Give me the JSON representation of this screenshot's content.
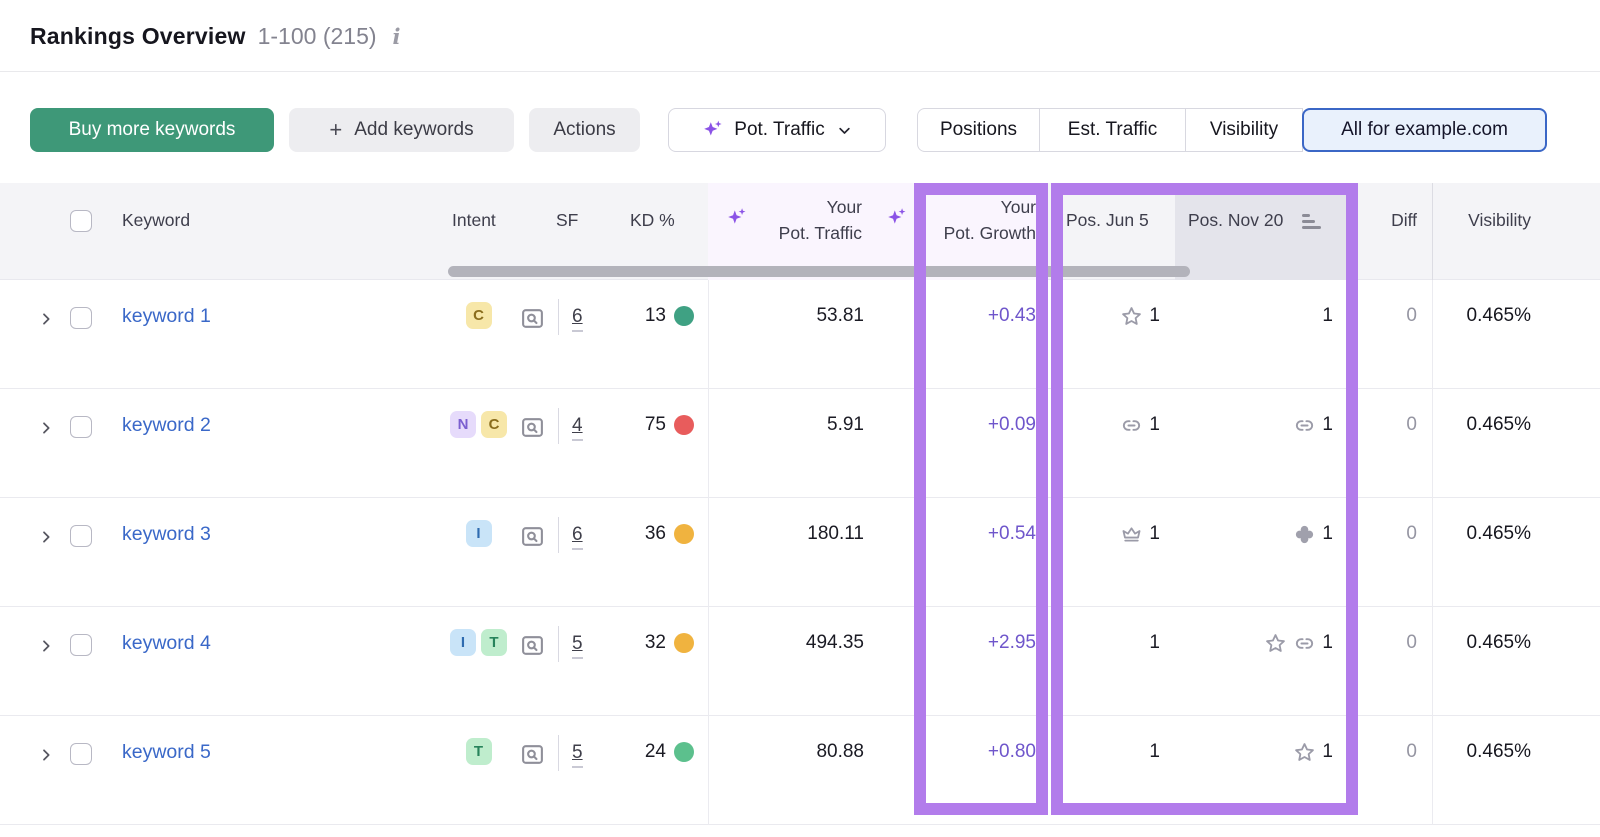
{
  "header": {
    "title": "Rankings Overview",
    "range": "1-100 (215)",
    "info_icon": "i"
  },
  "toolbar": {
    "buy_label": "Buy more keywords",
    "add_label": "Add keywords",
    "add_plus": "+",
    "actions_label": "Actions",
    "metric_dropdown_label": "Pot. Traffic",
    "tabs": [
      {
        "label": "Positions",
        "selected": false
      },
      {
        "label": "Est. Traffic",
        "selected": false
      },
      {
        "label": "Visibility",
        "selected": false
      },
      {
        "label": "All for example.com",
        "selected": true
      }
    ]
  },
  "table": {
    "columns": {
      "keyword": "Keyword",
      "intent": "Intent",
      "sf": "SF",
      "kd": "KD %",
      "pot_traffic_line1": "Your",
      "pot_traffic_line2": "Pot. Traffic",
      "pot_growth_line1": "Your",
      "pot_growth_line2": "Pot. Growth",
      "pos_jun5": "Pos. Jun 5",
      "pos_nov20": "Pos. Nov 20",
      "diff": "Diff",
      "visibility": "Visibility"
    },
    "sorted_column": "Pos. Nov 20",
    "rows": [
      {
        "keyword": "keyword 1",
        "intents": [
          "C"
        ],
        "sf": "6",
        "kd": "13",
        "kd_dot_color": "#3fa183",
        "pot_traffic": "53.81",
        "pot_growth": "+0.43",
        "pos_jun5": {
          "icons": [
            "star"
          ],
          "value": "1"
        },
        "pos_nov20": {
          "icons": [],
          "value": "1"
        },
        "diff": "0",
        "visibility": "0.465%"
      },
      {
        "keyword": "keyword 2",
        "intents": [
          "N",
          "C"
        ],
        "sf": "4",
        "kd": "75",
        "kd_dot_color": "#e85c5c",
        "pot_traffic": "5.91",
        "pot_growth": "+0.09",
        "pos_jun5": {
          "icons": [
            "link"
          ],
          "value": "1"
        },
        "pos_nov20": {
          "icons": [
            "link"
          ],
          "value": "1"
        },
        "diff": "0",
        "visibility": "0.465%"
      },
      {
        "keyword": "keyword 3",
        "intents": [
          "I"
        ],
        "sf": "6",
        "kd": "36",
        "kd_dot_color": "#f0b33f",
        "pot_traffic": "180.11",
        "pot_growth": "+0.54",
        "pos_jun5": {
          "icons": [
            "crown"
          ],
          "value": "1"
        },
        "pos_nov20": {
          "icons": [
            "clover"
          ],
          "value": "1"
        },
        "diff": "0",
        "visibility": "0.465%"
      },
      {
        "keyword": "keyword 4",
        "intents": [
          "I",
          "T"
        ],
        "sf": "5",
        "kd": "32",
        "kd_dot_color": "#f0b33f",
        "pot_traffic": "494.35",
        "pot_growth": "+2.95",
        "pos_jun5": {
          "icons": [],
          "value": "1"
        },
        "pos_nov20": {
          "icons": [
            "star",
            "link"
          ],
          "value": "1"
        },
        "diff": "0",
        "visibility": "0.465%"
      },
      {
        "keyword": "keyword 5",
        "intents": [
          "T"
        ],
        "sf": "5",
        "kd": "24",
        "kd_dot_color": "#5cc08d",
        "pot_traffic": "80.88",
        "pot_growth": "+0.80",
        "pos_jun5": {
          "icons": [],
          "value": "1"
        },
        "pos_nov20": {
          "icons": [
            "star"
          ],
          "value": "1"
        },
        "diff": "0",
        "visibility": "0.465%"
      }
    ]
  },
  "colors": {
    "highlight_purple": "#b27ceb",
    "accent_green": "#3e9878",
    "selected_tab_border": "#3b67c6",
    "selected_tab_bg": "#e9f1fc",
    "growth_text": "#6f56cb",
    "link_blue": "#3a68c8",
    "intent_badges": {
      "C": {
        "bg": "#f7e7a9",
        "fg": "#8a6d1d"
      },
      "N": {
        "bg": "#e6dbfb",
        "fg": "#7b5fd0"
      },
      "I": {
        "bg": "#c9e4f8",
        "fg": "#2e6bb0"
      },
      "T": {
        "bg": "#bfedcd",
        "fg": "#27835b"
      }
    }
  }
}
